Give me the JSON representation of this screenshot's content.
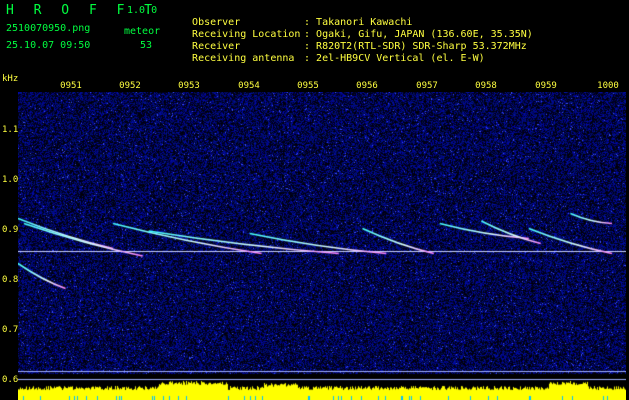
{
  "header": {
    "app_name": "H R O F F T",
    "version": "1.0.0",
    "filename": "2510070950.png",
    "meteor_label": "meteor",
    "datetime": "25.10.07 09:50",
    "meteor_count": "53"
  },
  "info": [
    {
      "key": "Observer",
      "sep": ":",
      "value": "Takanori Kawachi"
    },
    {
      "key": "Receiving Location",
      "sep": ":",
      "value": "Ogaki, Gifu, JAPAN (136.60E, 35.35N)"
    },
    {
      "key": "Receiver",
      "sep": ":",
      "value": "R820T2(RTL-SDR) SDR-Sharp 53.372MHz"
    },
    {
      "key": "Receiving antenna",
      "sep": ":",
      "value": "2el-HB9CV Vertical (el. E-W)"
    }
  ],
  "axis": {
    "unit": "kHz",
    "y_ticks": [
      "1.1",
      "1.0",
      "0.9",
      "0.8",
      "0.7",
      "0.6"
    ],
    "x_ticks": [
      "0951",
      "0952",
      "0953",
      "0954",
      "0955",
      "0956",
      "0957",
      "0958",
      "0959",
      "1000"
    ]
  },
  "colors": {
    "header_green": "#00ff40",
    "header_yellow": "#ffff40",
    "background": "#000000",
    "noise_blue": "#0000c8",
    "carrier_line": "#c8d0ff",
    "meteor_trace": "#40ffff",
    "signal_yellow": "#ffff00"
  },
  "meteor_traces": [
    {
      "t0": 0.0,
      "f0": 0.965,
      "t1": 1.6,
      "f1": 0.905
    },
    {
      "t0": 0.0,
      "f0": 0.875,
      "t1": 0.8,
      "f1": 0.825
    },
    {
      "t0": 0.1,
      "f0": 0.955,
      "t1": 2.1,
      "f1": 0.89
    },
    {
      "t0": 1.6,
      "f0": 0.955,
      "t1": 4.1,
      "f1": 0.895
    },
    {
      "t0": 2.2,
      "f0": 0.94,
      "t1": 5.4,
      "f1": 0.895
    },
    {
      "t0": 3.9,
      "f0": 0.935,
      "t1": 6.2,
      "f1": 0.895
    },
    {
      "t0": 5.8,
      "f0": 0.945,
      "t1": 7.0,
      "f1": 0.895
    },
    {
      "t0": 7.1,
      "f0": 0.955,
      "t1": 8.6,
      "f1": 0.925
    },
    {
      "t0": 7.8,
      "f0": 0.96,
      "t1": 8.8,
      "f1": 0.915
    },
    {
      "t0": 8.6,
      "f0": 0.945,
      "t1": 10.0,
      "f1": 0.895
    },
    {
      "t0": 9.3,
      "f0": 0.975,
      "t1": 10.0,
      "f1": 0.955
    }
  ]
}
